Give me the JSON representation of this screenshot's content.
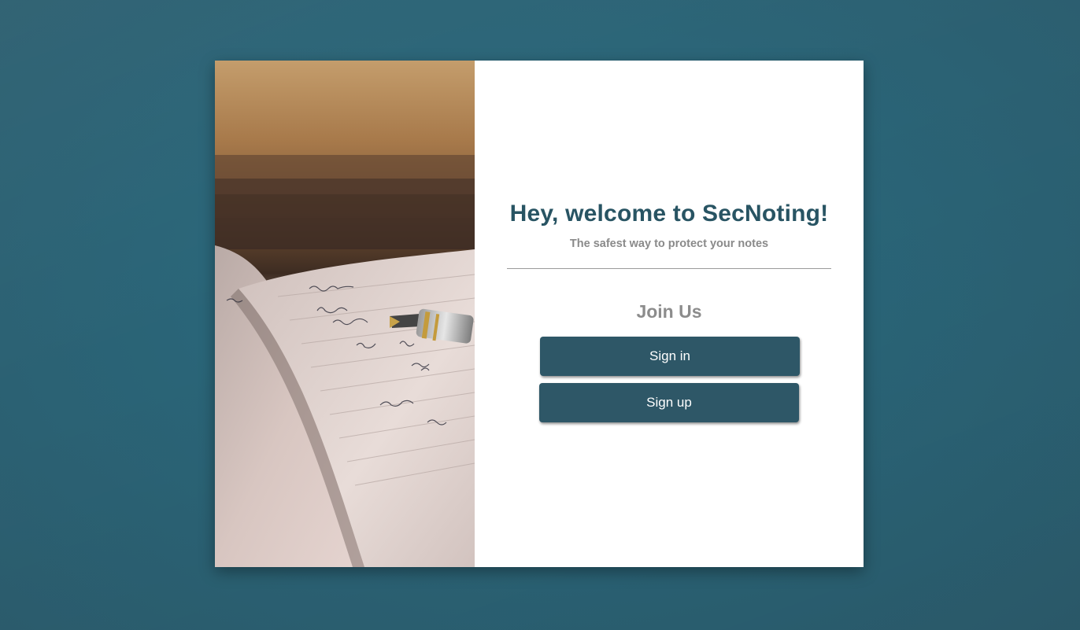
{
  "welcome": {
    "title": "Hey, welcome to SecNoting!",
    "subtitle": "The safest way to protect your notes"
  },
  "join": {
    "heading": "Join Us",
    "signin_label": "Sign in",
    "signup_label": "Sign up"
  },
  "colors": {
    "page_background": "#2a6578",
    "title": "#285463",
    "button": "#2e5767",
    "muted_text": "#8a8a8a"
  },
  "hero_image": {
    "subject": "notebook-with-fountain-pen-photo"
  }
}
